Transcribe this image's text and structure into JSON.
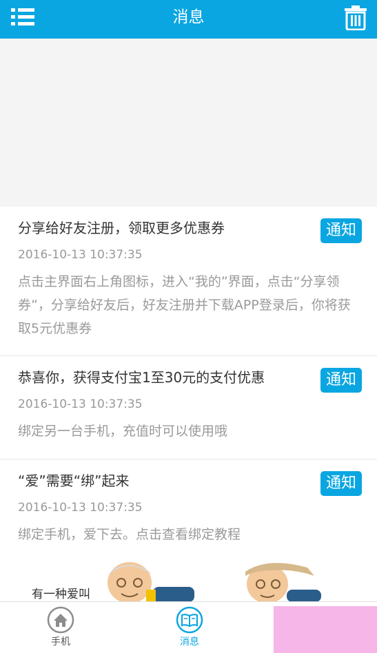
{
  "header": {
    "title": "消息",
    "background": "#0aa6e1",
    "left_icon": "menu-list-icon",
    "right_icon": "trash-icon"
  },
  "messages": [
    {
      "title": "分享给好友注册，领取更多优惠券",
      "badge": "通知",
      "time": "2016-10-13 10:37:35",
      "body": "点击主界面右上角图标，进入“我的”界面，点击“分享领券”，分享给好友后，好友注册并下载APP登录后，你将获取5元优惠券"
    },
    {
      "title": "恭喜你，获得支付宝1至30元的支付优惠",
      "badge": "通知",
      "time": "2016-10-13 10:37:35",
      "body": "绑定另一台手机，充值时可以使用哦"
    },
    {
      "title": "“爱”需要“绑”起来",
      "badge": "通知",
      "time": "2016-10-13 10:37:35",
      "body": "绑定手机，爱下去。点击查看绑定教程"
    }
  ],
  "promo": {
    "text": "有一种爱叫"
  },
  "tabbar": {
    "items": [
      {
        "label": "手机",
        "icon": "home-icon",
        "active": false
      },
      {
        "label": "消息",
        "icon": "book-icon",
        "active": true
      }
    ],
    "active_color": "#0aa6e1"
  }
}
